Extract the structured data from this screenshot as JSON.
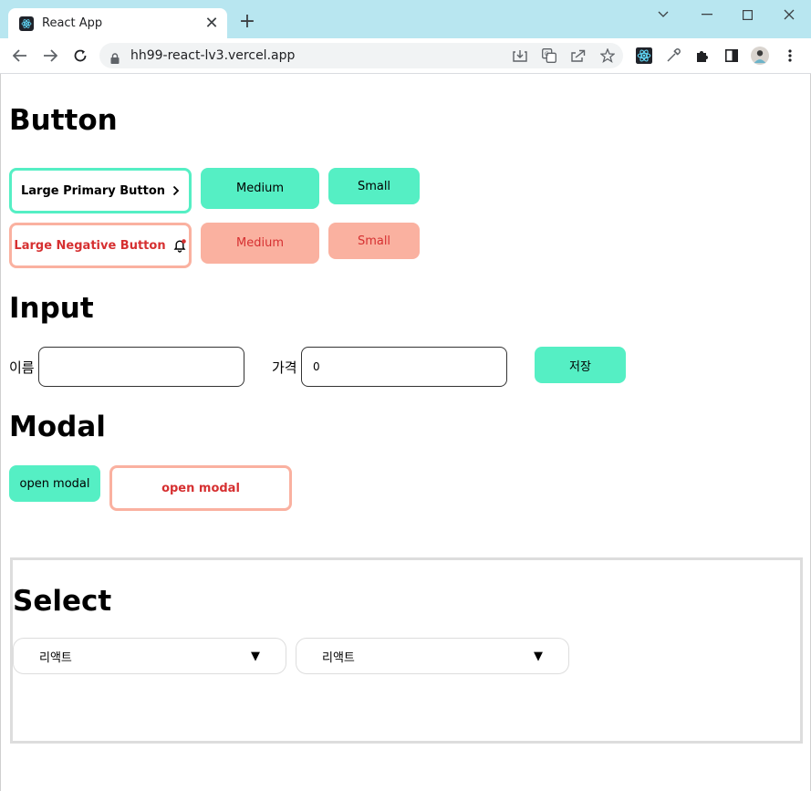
{
  "browser": {
    "tab_title": "React App",
    "tab_close": "✕",
    "new_tab": "+",
    "url": "hh99-react-lv3.vercel.app"
  },
  "button_section": {
    "title": "Button",
    "large_primary": "Large Primary Button",
    "large_primary_icon": "chevron-right-icon",
    "medium_primary": "Medium",
    "small_primary": "Small",
    "large_negative": "Large Negative Button",
    "large_negative_icon": "bell-icon",
    "medium_negative": "Medium",
    "small_negative": "Small"
  },
  "input_section": {
    "title": "Input",
    "name_label": "이름",
    "name_value": "",
    "price_label": "가격",
    "price_value": "0",
    "save_label": "저장"
  },
  "modal_section": {
    "title": "Modal",
    "open_modal_primary": "open modal",
    "open_modal_negative": "open modal"
  },
  "select_section": {
    "title": "Select",
    "select1_value": "리액트",
    "select2_value": "리액트",
    "arrow": "▼"
  },
  "colors": {
    "primary": "#55efc4",
    "negative": "#fab1a0",
    "negative_text": "#d63031",
    "browser_frame": "#b8e6f0"
  }
}
